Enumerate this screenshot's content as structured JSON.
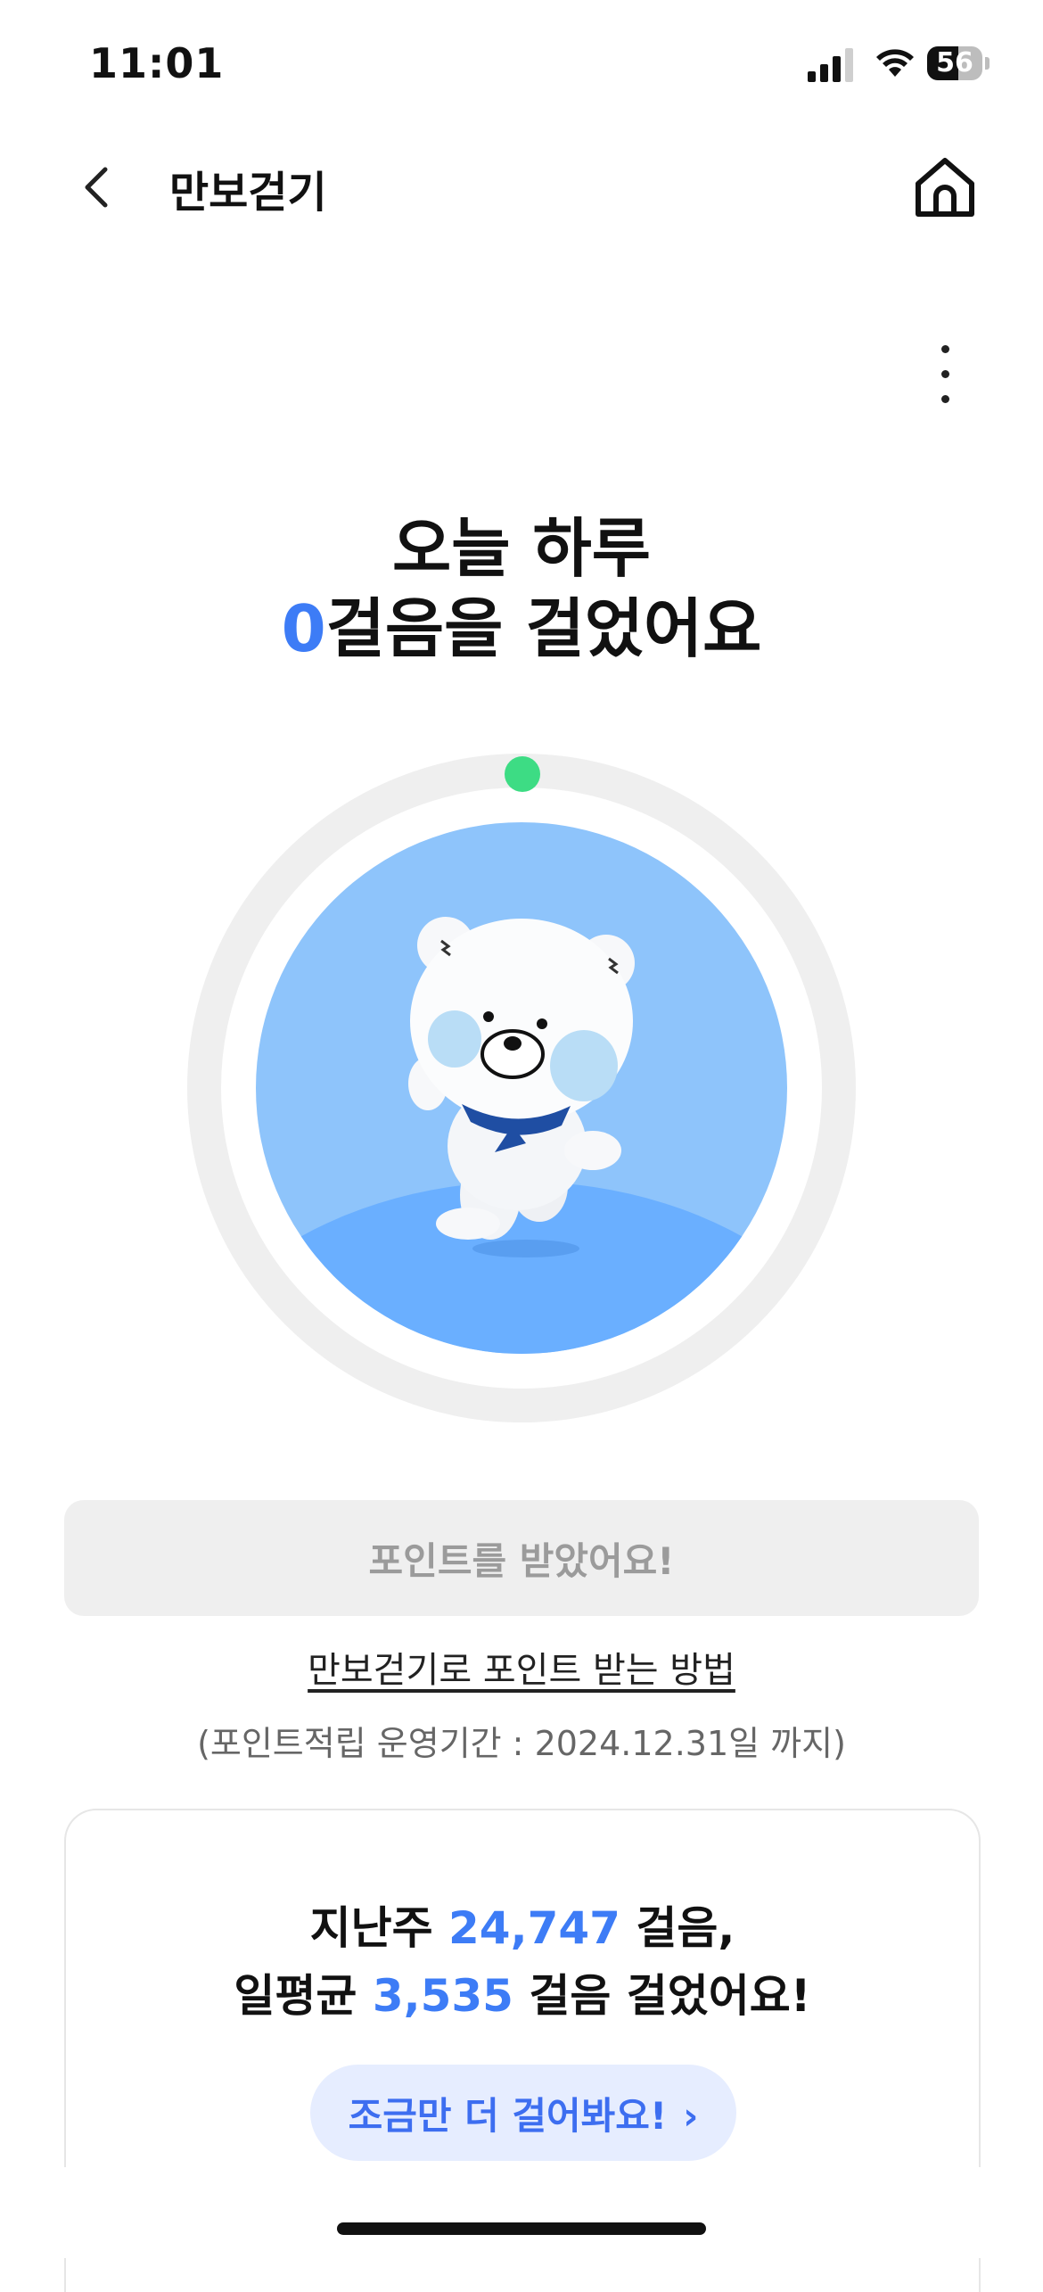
{
  "status_bar": {
    "time": "11:01",
    "battery": "56",
    "battery_level_percent": 56
  },
  "nav": {
    "title": "만보걷기"
  },
  "headline": {
    "line1": "오늘 하루",
    "step_count": "0",
    "line2_suffix": "걸음을 걸었어요"
  },
  "progress": {
    "steps_fraction": 0
  },
  "points_button": {
    "label": "포인트를 받았어요!"
  },
  "howto_link": {
    "label": "만보걷기로 포인트 받는 방법"
  },
  "period_note": {
    "text": "(포인트적립 운영기간 : 2024.12.31일 까지)"
  },
  "weekly": {
    "line1_prefix": "지난주",
    "weekly_steps": "24,747",
    "line1_suffix": "걸음,",
    "line2_prefix": "일평균",
    "daily_avg": "3,535",
    "line2_suffix": "걸음 걸었어요!",
    "cta_label": "조금만 더 걸어봐요!"
  },
  "colors": {
    "accent": "#3d7cf6",
    "progress_dot": "#3ddc84",
    "circle_bg": "#8ec4fb",
    "ground": "#6aafff"
  },
  "icons": {
    "back": "chevron-left-icon",
    "home": "home-icon",
    "more": "more-vertical-icon",
    "cta": "chevron-right-icon"
  }
}
